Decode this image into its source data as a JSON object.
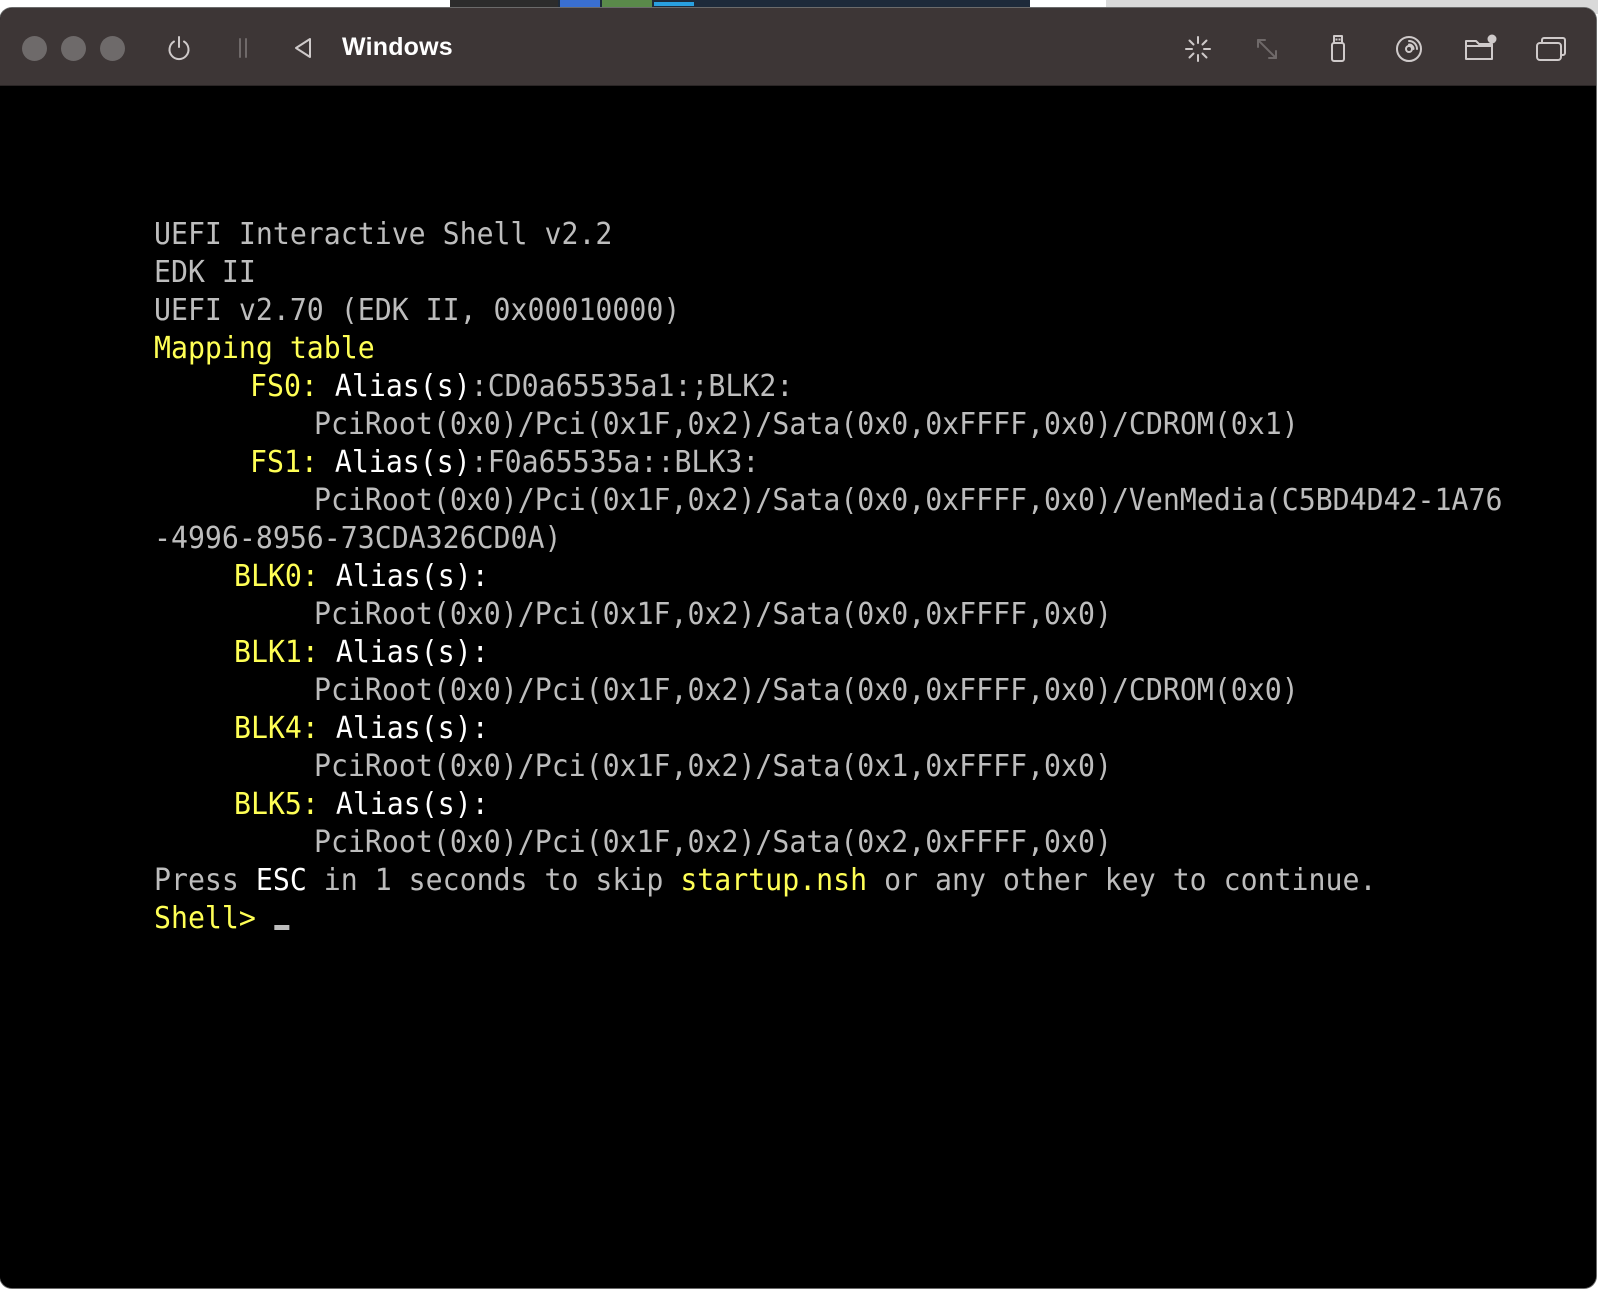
{
  "window": {
    "title": "Windows"
  },
  "toolbar": {
    "icons": [
      "power-icon",
      "pause-icon",
      "back-icon",
      "sparkle-icon",
      "resize-icon",
      "usb-icon",
      "disc-icon",
      "shared-folder-icon",
      "windows-icon"
    ]
  },
  "console": {
    "colors": {
      "gray": "#bdbdbd",
      "white": "#ffffff",
      "yellow": "#ffff55",
      "background": "#000000"
    },
    "header": [
      "UEFI Interactive Shell v2.2",
      "EDK II",
      "UEFI v2.70 (EDK II, 0x00010000)"
    ],
    "mapping_title": "Mapping table",
    "entries": [
      {
        "key": "FS0:",
        "alias_label": " Alias(s)",
        "alias_value": ":CD0a65535a1:;BLK2:",
        "path": "PciRoot(0x0)/Pci(0x1F,0x2)/Sata(0x0,0xFFFF,0x0)/CDROM(0x1)"
      },
      {
        "key": "FS1:",
        "alias_label": " Alias(s)",
        "alias_value": ":F0a65535a::BLK3:",
        "path": "PciRoot(0x0)/Pci(0x1F,0x2)/Sata(0x0,0xFFFF,0x0)/VenMedia(C5BD4D42-1A76",
        "path_cont": "-4996-8956-73CDA326CD0A)"
      },
      {
        "key": "BLK0:",
        "alias_label": " Alias(s)",
        "alias_value": ":",
        "path": "PciRoot(0x0)/Pci(0x1F,0x2)/Sata(0x0,0xFFFF,0x0)"
      },
      {
        "key": "BLK1:",
        "alias_label": " Alias(s)",
        "alias_value": ":",
        "path": "PciRoot(0x0)/Pci(0x1F,0x2)/Sata(0x0,0xFFFF,0x0)/CDROM(0x0)"
      },
      {
        "key": "BLK4:",
        "alias_label": " Alias(s)",
        "alias_value": ":",
        "path": "PciRoot(0x0)/Pci(0x1F,0x2)/Sata(0x1,0xFFFF,0x0)"
      },
      {
        "key": "BLK5:",
        "alias_label": " Alias(s)",
        "alias_value": ":",
        "path": "PciRoot(0x0)/Pci(0x1F,0x2)/Sata(0x2,0xFFFF,0x0)"
      }
    ],
    "startup": {
      "press": "Press ",
      "esc": "ESC",
      "middle": " in 1 seconds to skip ",
      "file": "startup.nsh",
      "end": " or any other key to continue."
    },
    "prompt": "Shell> "
  }
}
